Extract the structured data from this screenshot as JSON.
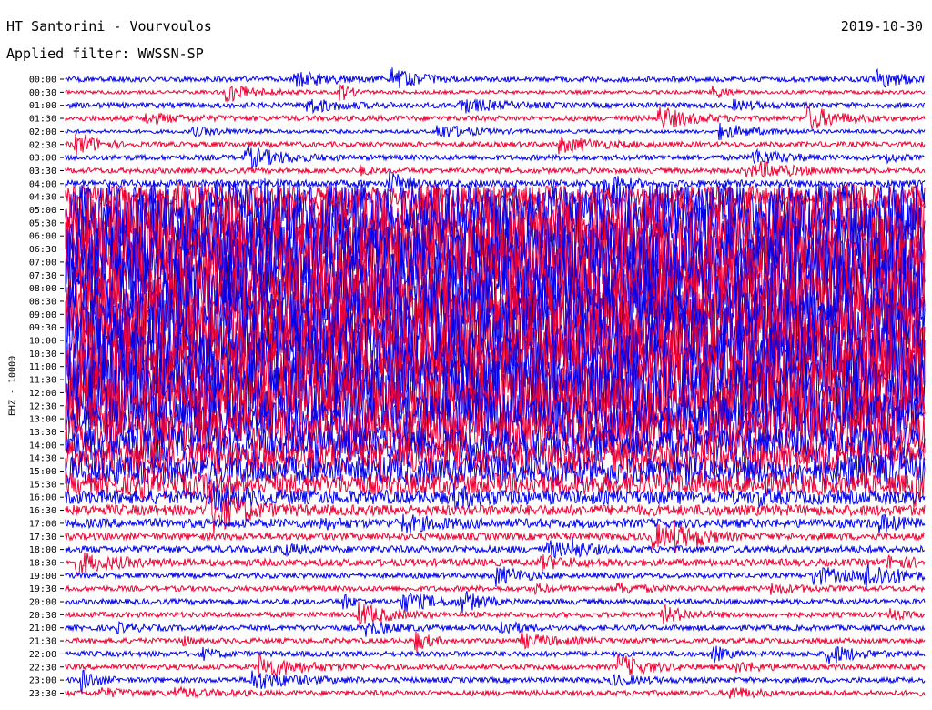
{
  "header": {
    "station": "HT Santorini - Vourvoulos",
    "date": "2019-10-30",
    "filter": "Applied filter: WWSSN-SP"
  },
  "chart_data": {
    "type": "line",
    "title": "HT Santorini - Vourvoulos",
    "ylabel": "EHZ - 10000",
    "grid": false,
    "colors": [
      "#0000ee",
      "#ee0033"
    ],
    "x_unit": "minutes",
    "xlim": [
      0,
      30
    ],
    "categories": [
      "00:00",
      "00:30",
      "01:00",
      "01:30",
      "02:00",
      "02:30",
      "03:00",
      "03:30",
      "04:00",
      "04:30",
      "05:00",
      "05:30",
      "06:00",
      "06:30",
      "07:00",
      "07:30",
      "08:00",
      "08:30",
      "09:00",
      "09:30",
      "10:00",
      "10:30",
      "11:00",
      "11:30",
      "12:00",
      "12:30",
      "13:00",
      "13:30",
      "14:00",
      "14:30",
      "15:00",
      "15:30",
      "16:00",
      "16:30",
      "17:00",
      "17:30",
      "18:00",
      "18:30",
      "19:00",
      "19:30",
      "20:00",
      "20:30",
      "21:00",
      "21:30",
      "22:00",
      "22:30",
      "23:00",
      "23:30"
    ],
    "series": [
      {
        "values": [
          3,
          2,
          3,
          3,
          2,
          3,
          3,
          3,
          4,
          12,
          30,
          36,
          38,
          38,
          40,
          40,
          38,
          38,
          38,
          38,
          38,
          38,
          38,
          38,
          38,
          32,
          26,
          24,
          20,
          18,
          16,
          12,
          8,
          6,
          5,
          4,
          4,
          4,
          3,
          3,
          3,
          3,
          3,
          3,
          3,
          3,
          3,
          3
        ]
      }
    ]
  }
}
